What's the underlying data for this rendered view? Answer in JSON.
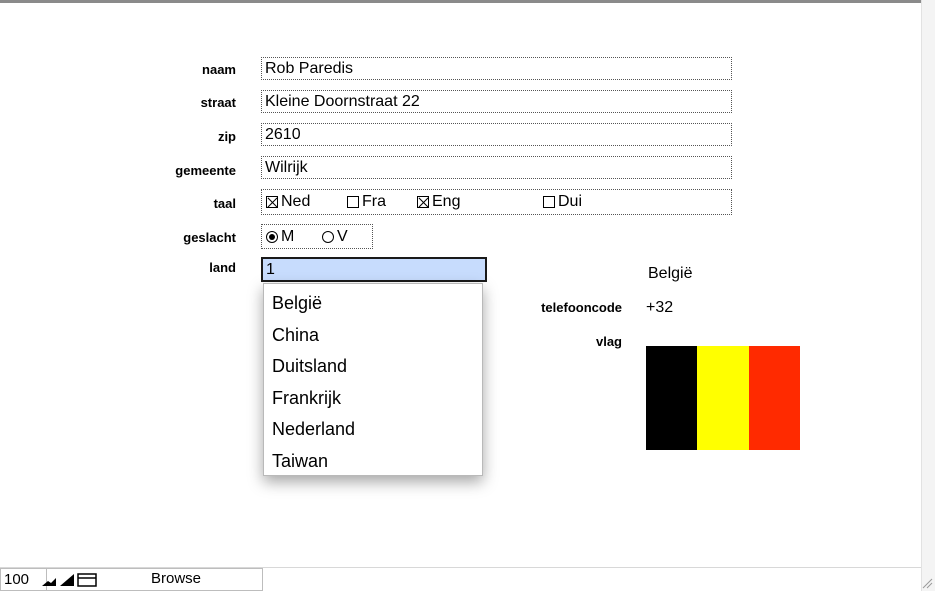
{
  "form": {
    "labels": {
      "naam": "naam",
      "straat": "straat",
      "zip": "zip",
      "gemeente": "gemeente",
      "taal": "taal",
      "geslacht": "geslacht",
      "land": "land",
      "telefooncode": "telefooncode",
      "vlag": "vlag"
    },
    "values": {
      "naam": "Rob Paredis",
      "straat": "Kleine Doornstraat 22",
      "zip": "2610",
      "gemeente": "Wilrijk",
      "land": "1"
    },
    "taal": [
      {
        "label": "Ned",
        "checked": true
      },
      {
        "label": "Fra",
        "checked": false
      },
      {
        "label": "Eng",
        "checked": true
      },
      {
        "label": "Dui",
        "checked": false
      }
    ],
    "geslacht": [
      {
        "label": "M",
        "selected": true
      },
      {
        "label": "V",
        "selected": false
      }
    ]
  },
  "dropdown": {
    "options": [
      "België",
      "China",
      "Duitsland",
      "Frankrijk",
      "Nederland",
      "Taiwan"
    ]
  },
  "country": {
    "name": "België",
    "phone_code": "+32",
    "flag_colors": [
      "#000000",
      "#ffff00",
      "#ff2a00"
    ]
  },
  "status_bar": {
    "zoom": "100",
    "mode": "Browse"
  }
}
